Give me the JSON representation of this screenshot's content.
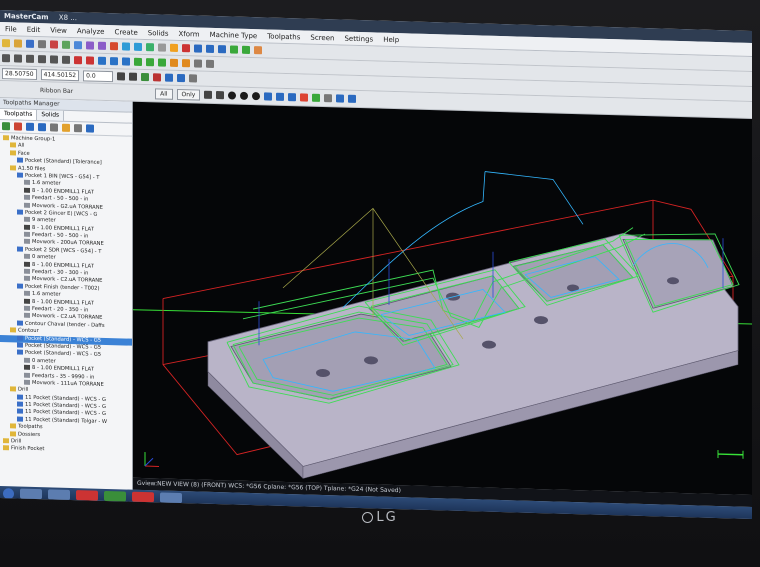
{
  "window": {
    "app_name": "MasterCam",
    "title_rest": "X8 ..."
  },
  "menu": [
    "File",
    "Edit",
    "View",
    "Analyze",
    "Create",
    "Solids",
    "Xform",
    "Machine Type",
    "Toolpaths",
    "Screen",
    "Settings",
    "Help"
  ],
  "coords": {
    "x_value": "28.50750",
    "y_value": "414.50152",
    "z_value": "0.0"
  },
  "ribbon_bar_label": "Ribbon Bar",
  "attrib_buttons": [
    "All",
    "Only"
  ],
  "manager": {
    "title": "Toolpaths Manager",
    "tabs": [
      "Toolpaths",
      "Solids"
    ]
  },
  "tree": [
    {
      "label": "Machine Group-1",
      "indent": 0,
      "icon": "folder-icon"
    },
    {
      "label": "All",
      "indent": 1,
      "icon": "folder-icon"
    },
    {
      "label": "Face",
      "indent": 1,
      "icon": "folder-icon"
    },
    {
      "label": "Pocket (Standard) [Tolerance]",
      "indent": 2,
      "icon": "op-icon"
    },
    {
      "label": "A1.50 files",
      "indent": 1,
      "icon": "folder-icon"
    },
    {
      "label": "Pocket 1 BIN [WCS - G54] - T",
      "indent": 2,
      "icon": "op-icon"
    },
    {
      "label": "1.6 ameter",
      "indent": 3,
      "icon": "param-icon"
    },
    {
      "label": "8 - 1.00 ENDMILL1 FLAT",
      "indent": 3,
      "icon": "tool-icon"
    },
    {
      "label": "Feedart - 50 - 500 - in",
      "indent": 3,
      "icon": "param-icon"
    },
    {
      "label": "Movwork - G2.uA TORRANE",
      "indent": 3,
      "icon": "param-icon"
    },
    {
      "label": "Pocket 2 Gincer E) [WCS - G",
      "indent": 2,
      "icon": "op-icon"
    },
    {
      "label": "9 ameter",
      "indent": 3,
      "icon": "param-icon"
    },
    {
      "label": "8 - 1.00 ENDMILL1 FLAT",
      "indent": 3,
      "icon": "tool-icon"
    },
    {
      "label": "Feedart - 50 - 500 - in",
      "indent": 3,
      "icon": "param-icon"
    },
    {
      "label": "Movwork - 200uA TORRANE",
      "indent": 3,
      "icon": "param-icon"
    },
    {
      "label": "Pocket 2 SDR [WCS - G54] - T",
      "indent": 2,
      "icon": "op-icon"
    },
    {
      "label": "0 ameter",
      "indent": 3,
      "icon": "param-icon"
    },
    {
      "label": "8 - 1.00 ENDMILL1 FLAT",
      "indent": 3,
      "icon": "tool-icon"
    },
    {
      "label": "Feedart - 30 - 300 - in",
      "indent": 3,
      "icon": "param-icon"
    },
    {
      "label": "Movwork - C2.uA TORRANE",
      "indent": 3,
      "icon": "param-icon"
    },
    {
      "label": "Pocket Finish (tender - T002)",
      "indent": 2,
      "icon": "op-icon"
    },
    {
      "label": "1.6 ameter",
      "indent": 3,
      "icon": "param-icon"
    },
    {
      "label": "8 - 1.00 ENDMILL1 FLAT",
      "indent": 3,
      "icon": "tool-icon"
    },
    {
      "label": "Feedart - 20 - 350 - in",
      "indent": 3,
      "icon": "param-icon"
    },
    {
      "label": "Movwork - C2.uA TORRANE",
      "indent": 3,
      "icon": "param-icon"
    },
    {
      "label": "Contour Chaval (tender - Daffs",
      "indent": 2,
      "icon": "op-icon"
    },
    {
      "label": "Contour",
      "indent": 1,
      "icon": "folder-icon"
    },
    {
      "label": "Pocket (Standard) - WCS - G5",
      "indent": 2,
      "icon": "op-icon",
      "selected": true
    },
    {
      "label": "Pocket (Standard) - WCS - G5",
      "indent": 2,
      "icon": "op-icon"
    },
    {
      "label": "Pocket (Standard) - WCS - G5",
      "indent": 2,
      "icon": "op-icon"
    },
    {
      "label": "0 ameter",
      "indent": 3,
      "icon": "param-icon"
    },
    {
      "label": "8 - 1.00 ENDMILL1 FLAT",
      "indent": 3,
      "icon": "tool-icon"
    },
    {
      "label": "Feedarts - 35 - 9990 - in",
      "indent": 3,
      "icon": "param-icon"
    },
    {
      "label": "Movwork - 111uA TORRANE",
      "indent": 3,
      "icon": "param-icon"
    },
    {
      "label": "Drill",
      "indent": 1,
      "icon": "folder-icon"
    },
    {
      "label": "11 Pocket (Standard) - WCS - G",
      "indent": 2,
      "icon": "op-icon"
    },
    {
      "label": "11 Pocket (Standard) - WCS - G",
      "indent": 2,
      "icon": "op-icon"
    },
    {
      "label": "11 Pocket (Standard) - WCS - G",
      "indent": 2,
      "icon": "op-icon"
    },
    {
      "label": "11 Pocket (Standard) Tolgar - W",
      "indent": 2,
      "icon": "op-icon"
    },
    {
      "label": "Toolpaths",
      "indent": 1,
      "icon": "folder-icon"
    },
    {
      "label": "Dossiers",
      "indent": 1,
      "icon": "folder-icon"
    },
    {
      "label": "Drill",
      "indent": 0,
      "icon": "folder-icon"
    },
    {
      "label": "Finish Pocket",
      "indent": 0,
      "icon": "folder-icon"
    }
  ],
  "status": {
    "text": "Gview:NEW VIEW (8) (FRONT)   WCS: *G56   Cplane: *G56 (TOP)   Tplane: *G24 (Not Saved)"
  },
  "monitor_brand": "LG",
  "colors": {
    "part_face": "#b9b4c8",
    "toolpath_green": "#3ddc54",
    "toolpath_cyan": "#33b7ff",
    "stock_red": "#d42323",
    "axis_green": "#38e038",
    "viewport_bg": "#050608"
  }
}
